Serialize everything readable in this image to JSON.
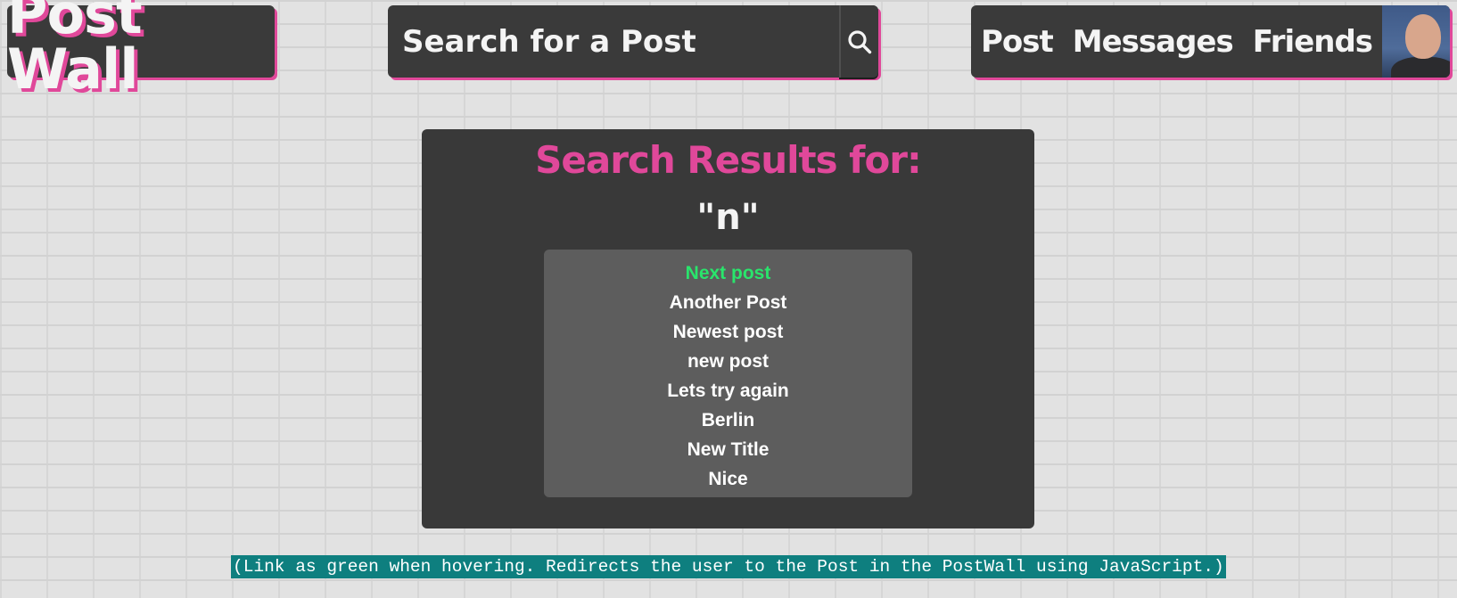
{
  "header": {
    "logo_text": "Post Wall",
    "search": {
      "placeholder": "Search for a Post",
      "value": "",
      "button_icon": "search-icon"
    },
    "nav": {
      "post_label": "Post",
      "messages_label": "Messages",
      "friends_label": "Friends",
      "avatar_icon": "user-avatar"
    }
  },
  "results": {
    "title": "Search Results for:",
    "query": "\"n\"",
    "items": [
      "Next post",
      "Another Post",
      "Newest post",
      "new post",
      "Lets try again",
      "Berlin",
      "New Title",
      "Nice"
    ],
    "hovered_index": 0
  },
  "annotation": "(Link as green when hovering. Redirects the user to the Post in the PostWall using JavaScript.)",
  "colors": {
    "accent_pink": "#e0489a",
    "hover_green": "#29e56c",
    "card_bg": "#3a3a3a",
    "list_bg": "#5d5d5d",
    "note_bg": "#0e7f7f"
  }
}
